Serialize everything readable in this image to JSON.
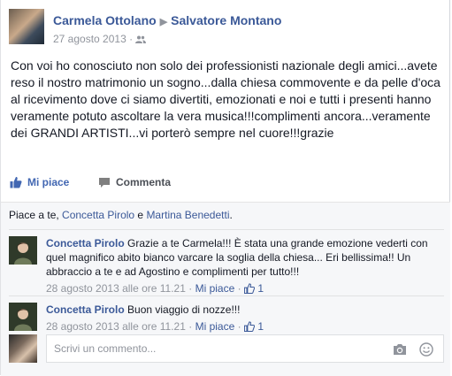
{
  "post": {
    "author": "Carmela Ottolano",
    "target": "Salvatore Montano",
    "arrow": "▶",
    "date": "27 agosto 2013",
    "separator": "·",
    "text": "Con voi ho conosciuto non solo dei professionisti nazionale degli amici...avete reso il nostro matrimonio un sogno...dalla chiesa commovente e da pelle d'oca al ricevimento dove ci siamo divertiti, emozionati e noi e tutti i presenti hanno veramente potuto ascoltare la vera musica!!!complimenti ancora...veramente dei GRANDI ARTISTI...vi porterò sempre nel cuore!!!grazie"
  },
  "actions": {
    "like_label": "Mi piace",
    "comment_label": "Commenta"
  },
  "likes": {
    "prefix": "Piace a te, ",
    "person1": "Concetta Pirolo",
    "conjunction": " e ",
    "person2": "Martina Benedetti",
    "suffix": "."
  },
  "comments": [
    {
      "author": "Concetta Pirolo",
      "text": "Grazie a te Carmela!!! È stata una grande emozione vederti con quel magnifico abito bianco varcare la soglia della chiesa... Eri bellissima!! Un abbraccio a te e ad Agostino e complimenti per tutto!!!",
      "timestamp": "28 agosto 2013 alle ore 11.21",
      "separator": "·",
      "like_label": "Mi piace",
      "like_count": "1"
    },
    {
      "author": "Concetta Pirolo",
      "text": "Buon viaggio di nozze!!!",
      "timestamp": "28 agosto 2013 alle ore 11.21",
      "separator": "·",
      "like_label": "Mi piace",
      "like_count": "1"
    }
  ],
  "composer": {
    "placeholder": "Scrivi un commento..."
  },
  "icons": {
    "friends": "friends-audience-icon",
    "like": "thumbs-up-icon",
    "comment": "speech-bubble-icon",
    "camera": "camera-icon",
    "emoji": "emoji-icon"
  },
  "colors": {
    "link": "#3b5998",
    "action_like": "#4267b2",
    "muted": "#90949c",
    "text": "#141823",
    "ufi_bg": "#f6f7f9"
  }
}
